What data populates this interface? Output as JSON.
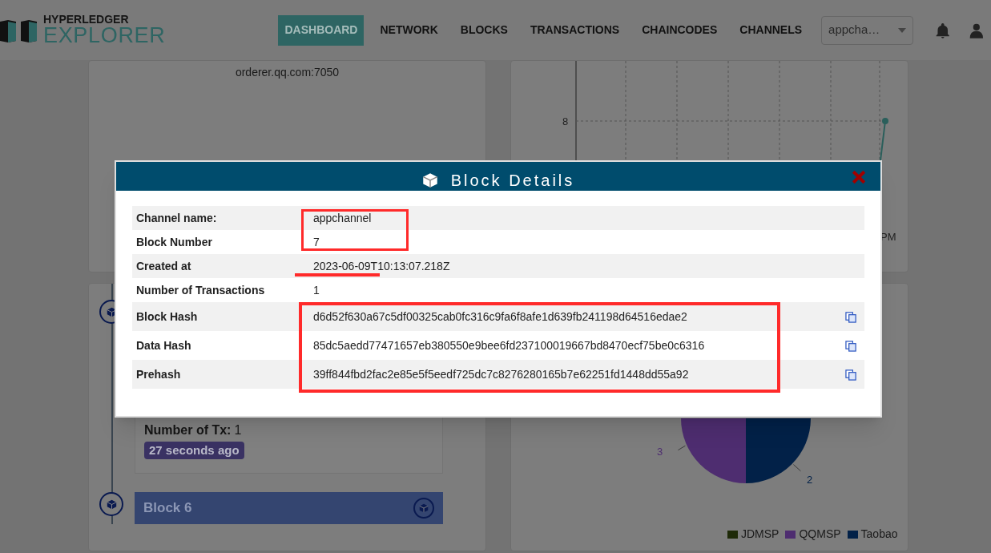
{
  "header": {
    "logo_top": "HYPERLEDGER",
    "logo_bottom": "EXPLORER",
    "nav": [
      {
        "label": "DASHBOARD",
        "selected": true
      },
      {
        "label": "NETWORK",
        "selected": false
      },
      {
        "label": "BLOCKS",
        "selected": false
      },
      {
        "label": "TRANSACTIONS",
        "selected": false
      },
      {
        "label": "CHAINCODES",
        "selected": false
      },
      {
        "label": "CHANNELS",
        "selected": false
      }
    ],
    "channel_select": {
      "value": "appcha…"
    }
  },
  "orderer_card": {
    "text": "orderer.qq.com:7050"
  },
  "tx_chart": {
    "y_label": "8",
    "x_label": "PM"
  },
  "block_list": {
    "tx_label": "Number of Tx:",
    "tx_count": "1",
    "age": "27 seconds ago",
    "next_block": "Block 6"
  },
  "org_pie": {
    "slice_labels": [
      "3",
      "2"
    ],
    "legend": [
      {
        "label": "JDMSP",
        "color": "#1e2a08"
      },
      {
        "label": "QQMSP",
        "color": "#4e2d70"
      },
      {
        "label": "Taobao",
        "color": "#022148"
      }
    ]
  },
  "modal": {
    "title": "Block Details",
    "rows": [
      {
        "label": "Channel name:",
        "value": "appchannel",
        "kind": "text"
      },
      {
        "label": "Block Number",
        "value": "7",
        "kind": "text"
      },
      {
        "label": "Created at",
        "value": "2023-06-09T10:13:07.218Z",
        "kind": "text"
      },
      {
        "label": "Number of Transactions",
        "value": "1",
        "kind": "text"
      },
      {
        "label": "Block Hash",
        "value": "d6d52f630a67c5df00325cab0fc316c9fa6f8afe1d639fb241198d64516edae2",
        "kind": "hash"
      },
      {
        "label": "Data Hash",
        "value": "85dc5aedd77471657eb380550e9bee6fd237100019667bd8470ecf75be0c6316",
        "kind": "hash"
      },
      {
        "label": "Prehash",
        "value": "39ff844fbd2fac2e85e5f5eedf725dc7c8276280165b7e62251fd1448dd55a92",
        "kind": "hash"
      }
    ]
  }
}
